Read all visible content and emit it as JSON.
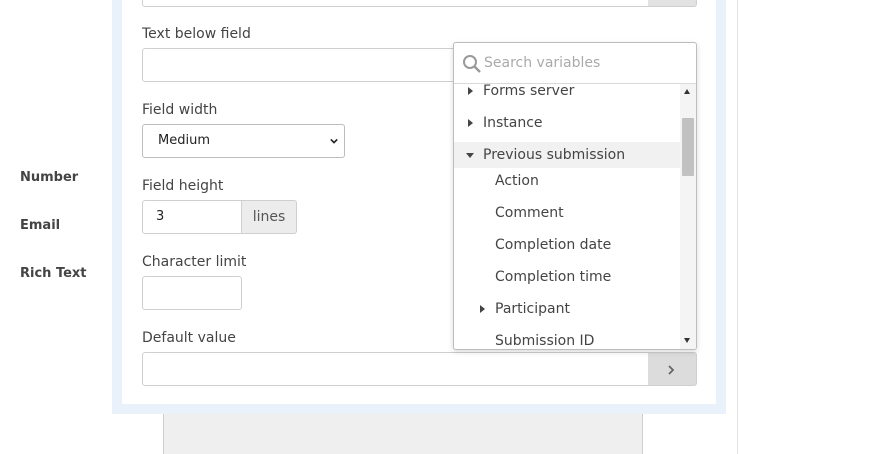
{
  "left_nav": {
    "items": [
      {
        "label": "Number"
      },
      {
        "label": "Email"
      },
      {
        "label": "Rich Text"
      }
    ]
  },
  "form": {
    "text_below_label": "Text below field",
    "text_below_value": "",
    "field_width_label": "Field width",
    "field_width_value": "Medium",
    "field_height_label": "Field height",
    "field_height_value": "3",
    "field_height_unit": "lines",
    "character_limit_label": "Character limit",
    "character_limit_value": "",
    "default_value_label": "Default value",
    "default_value_value": ""
  },
  "variables_dropdown": {
    "search_placeholder": "Search variables",
    "items": [
      {
        "label": "Forms server",
        "expanded": false,
        "level": 0
      },
      {
        "label": "Instance",
        "expanded": false,
        "level": 0
      },
      {
        "label": "Previous submission",
        "expanded": true,
        "level": 0,
        "highlighted": true
      },
      {
        "label": "Action",
        "level": 1
      },
      {
        "label": "Comment",
        "level": 1
      },
      {
        "label": "Completion date",
        "level": 1
      },
      {
        "label": "Completion time",
        "level": 1
      },
      {
        "label": "Participant",
        "expanded": false,
        "level": 1
      },
      {
        "label": "Submission ID",
        "level": 1
      }
    ]
  },
  "icons": {
    "search": "search-icon",
    "select_arrow": "chevron-down-icon",
    "insert": "chevron-right-icon"
  },
  "colors": {
    "panel_border": "#e9f1fb",
    "button_gray": "#dcdcdc"
  }
}
